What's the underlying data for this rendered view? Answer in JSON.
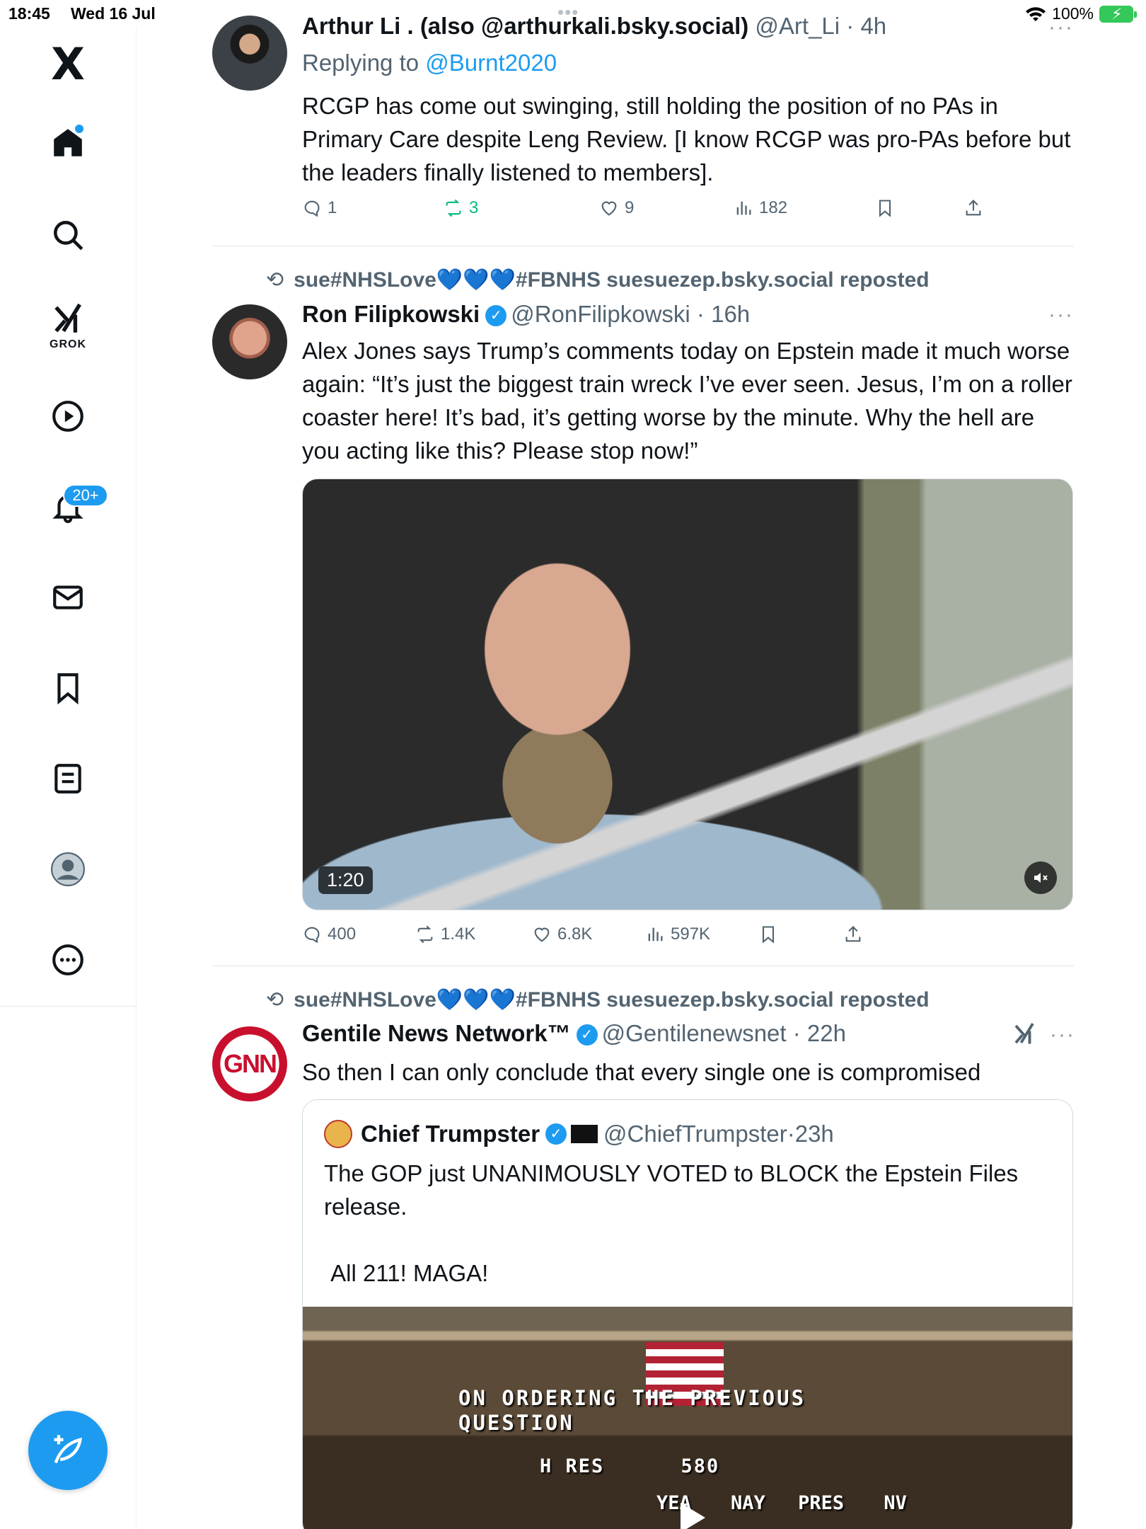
{
  "status_bar": {
    "time": "18:45",
    "date": "Wed 16 Jul",
    "battery": "100%"
  },
  "sidebar": {
    "logo": "X",
    "grok_label": "GROK",
    "notifications_badge": "20+"
  },
  "tweets": [
    {
      "name": "Arthur Li . (also @arthurkali.bsky.social)",
      "handle": "@Art_Li",
      "time": "4h",
      "replying_to_label": "Replying to",
      "replying_to": "@Burnt2020",
      "text": "RCGP has come out swinging, still holding the position of no PAs in Primary Care despite Leng Review. [I know RCGP was pro-PAs before but the leaders finally listened to members].",
      "replies": "1",
      "reposts": "3",
      "likes": "9",
      "views": "182"
    },
    {
      "reposted_by": "sue#NHSLove💙💙💙#FBNHS suesuezep.bsky.social reposted",
      "name": "Ron Filipkowski",
      "handle": "@RonFilipkowski",
      "time": "16h",
      "text": "Alex Jones says Trump’s comments today on Epstein made it much worse again: “It’s just the biggest train wreck I’ve ever seen. Jesus, I’m on a roller coaster here! It’s bad, it’s getting worse by the minute. Why the hell are you acting like this? Please stop now!”",
      "video_duration": "1:20",
      "replies": "400",
      "reposts": "1.4K",
      "likes": "6.8K",
      "views": "597K"
    },
    {
      "reposted_by": "sue#NHSLove💙💙💙#FBNHS suesuezep.bsky.social reposted",
      "name": "Gentile News Network™",
      "handle": "@Gentilenewsnet",
      "time": "22h",
      "avatar_text": "GNN",
      "text": "So then I can only conclude that every single one is compromised",
      "quote": {
        "name": "Chief Trumpster",
        "handle": "@ChiefTrumpster",
        "time": "23h",
        "text": "The GOP just UNANIMOUSLY VOTED to BLOCK the Epstein Files release.\n\n All 211! MAGA!",
        "video_caption_line1": "ON ORDERING THE PREVIOUS",
        "video_caption_line2": "QUESTION",
        "video_bill": "H RES",
        "video_bill_number": "580",
        "video_cols": [
          "YEA",
          "NAY",
          "PRES",
          "NV"
        ]
      }
    }
  ]
}
